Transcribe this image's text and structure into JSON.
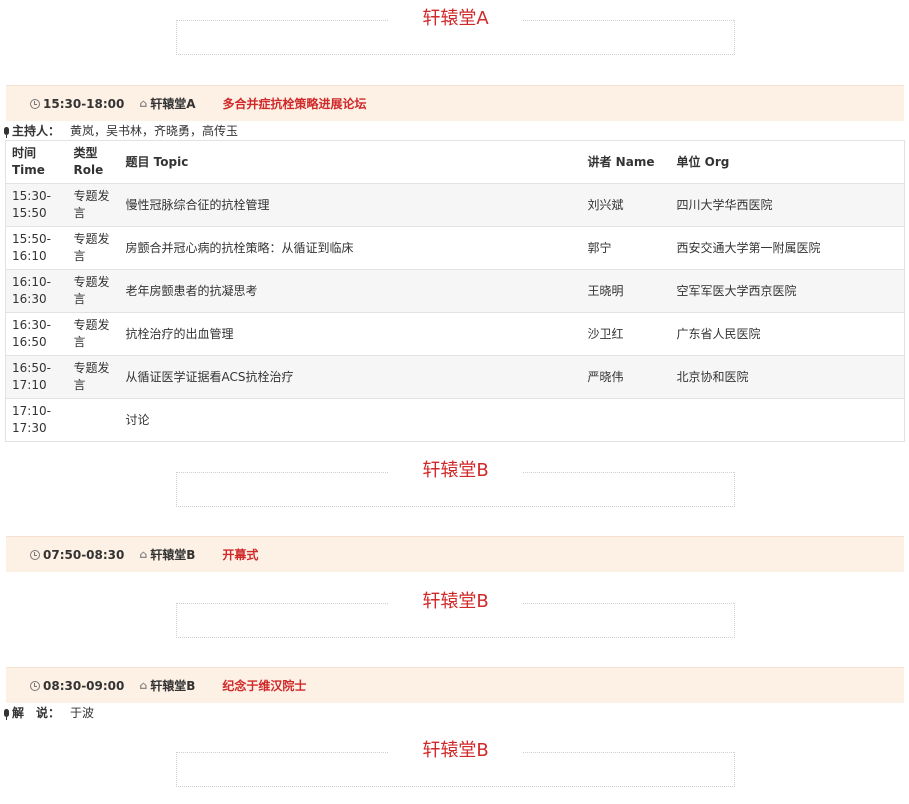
{
  "hall_a_header": "轩辕堂A",
  "session1": {
    "time": "15:30-18:00",
    "room": "轩辕堂A",
    "title": "多合并症抗栓策略进展论坛",
    "host_label": "主持人：",
    "host_names": "黄岚，吴书林，齐晓勇，高传玉"
  },
  "table": {
    "headers": {
      "time": "时间 Time",
      "role": "类型 Role",
      "topic": "题目 Topic",
      "name": "讲者 Name",
      "org": "单位 Org"
    },
    "rows": [
      {
        "time": "15:30-15:50",
        "role": "专题发言",
        "topic": "慢性冠脉综合征的抗栓管理",
        "name": "刘兴斌",
        "org": "四川大学华西医院"
      },
      {
        "time": "15:50-16:10",
        "role": "专题发言",
        "topic": "房颤合并冠心病的抗栓策略：从循证到临床",
        "name": "郭宁",
        "org": "西安交通大学第一附属医院"
      },
      {
        "time": "16:10-16:30",
        "role": "专题发言",
        "topic": "老年房颤患者的抗凝思考",
        "name": "王晓明",
        "org": "空军军医大学西京医院"
      },
      {
        "time": "16:30-16:50",
        "role": "专题发言",
        "topic": "抗栓治疗的出血管理",
        "name": "沙卫红",
        "org": "广东省人民医院"
      },
      {
        "time": "16:50-17:10",
        "role": "专题发言",
        "topic": "从循证医学证据看ACS抗栓治疗",
        "name": "严晓伟",
        "org": "北京协和医院"
      },
      {
        "time": "17:10-17:30",
        "role": "",
        "topic": "讨论",
        "name": "",
        "org": ""
      }
    ]
  },
  "hall_b_header": "轩辕堂B",
  "session2": {
    "time": "07:50-08:30",
    "room": "轩辕堂B",
    "title": "开幕式"
  },
  "session3": {
    "time": "08:30-09:00",
    "room": "轩辕堂B",
    "title": "纪念于维汉院士",
    "host_label": "解　说：",
    "host_names": "于波"
  },
  "icons": {
    "clock": "clock-icon",
    "home": "home-icon",
    "mic": "microphone-icon"
  },
  "colors": {
    "accent_red": "#d0292a",
    "session_bar_bg": "#fdf0e5",
    "row_stripe": "#f6f6f6"
  }
}
